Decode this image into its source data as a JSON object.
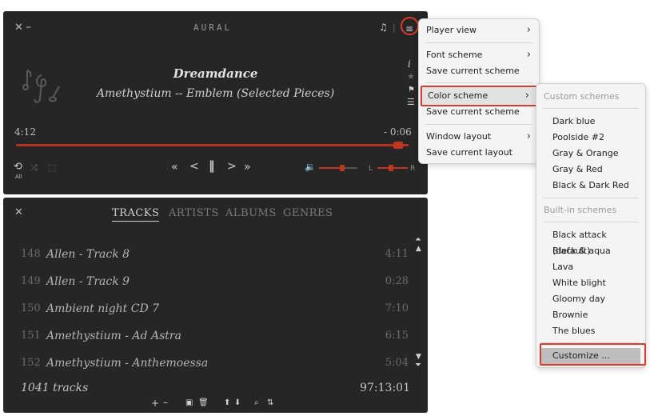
{
  "player": {
    "title": "AURAL",
    "track_title": "Dreamdance",
    "track_subtitle": "Amethystium -- Emblem (Selected Pieces)",
    "elapsed": "4:12",
    "remaining": "- 0:06",
    "repeat_label": "All",
    "balance_left": "L",
    "balance_right": "R",
    "progress_fraction": 0.985,
    "volume_fraction": 0.6,
    "balance_fraction": 0.45
  },
  "playlist": {
    "tabs": [
      "TRACKS",
      "ARTISTS",
      "ALBUMS",
      "GENRES"
    ],
    "rows": [
      {
        "num": "148",
        "name": "Allen - Track 8",
        "dur": "4:11"
      },
      {
        "num": "149",
        "name": "Allen - Track 9",
        "dur": "0:28"
      },
      {
        "num": "150",
        "name": "Ambient night CD 7",
        "dur": "7:10"
      },
      {
        "num": "151",
        "name": "Amethystium - Ad Astra",
        "dur": "6:15"
      },
      {
        "num": "152",
        "name": "Amethystium - Anthemoessa",
        "dur": "5:04"
      }
    ],
    "count": "1041 tracks",
    "total": "97:13:01"
  },
  "menu": {
    "player_view": "Player view",
    "font_scheme": "Font scheme",
    "save_scheme_1": "Save current scheme",
    "color_scheme": "Color scheme",
    "save_scheme_2": "Save current scheme",
    "window_layout": "Window layout",
    "save_layout": "Save current layout"
  },
  "submenu": {
    "custom_header": "Custom schemes",
    "custom": [
      "Dark blue",
      "Poolside #2",
      "Gray & Orange",
      "Gray & Red",
      "Black & Dark Red"
    ],
    "builtin_header": "Built-in schemes",
    "builtin": [
      "Black attack (default)",
      "Black & aqua",
      "Lava",
      "White blight",
      "Gloomy day",
      "Brownie",
      "The blues"
    ],
    "customize": "Customize ..."
  },
  "colors": {
    "accent": "#c0371f",
    "highlight_box": "#e0382a",
    "panel": "#262626"
  }
}
